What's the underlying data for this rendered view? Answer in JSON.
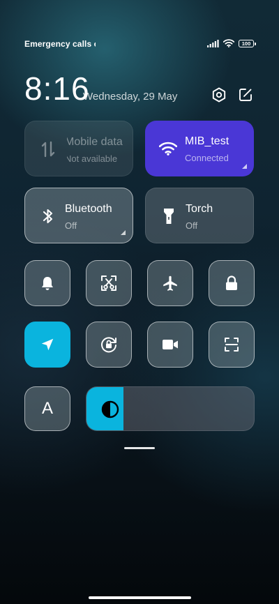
{
  "status_bar": {
    "carrier_text": "Emergency calls o",
    "battery_level": "100"
  },
  "header": {
    "time": "8:16",
    "date": "Wednesday, 29 May"
  },
  "tiles": {
    "mobile_data": {
      "title": "Mobile data",
      "status": "Not available"
    },
    "wifi": {
      "title": "MIB_test",
      "status": "Connected"
    },
    "bluetooth": {
      "title": "Bluetooth",
      "status": "Off"
    },
    "torch": {
      "title": "Torch",
      "status": "Off"
    }
  },
  "toggles": [
    {
      "icon": "bell-icon",
      "active": false
    },
    {
      "icon": "screenshot-icon",
      "active": false
    },
    {
      "icon": "airplane-icon",
      "active": false
    },
    {
      "icon": "lock-icon",
      "active": false
    },
    {
      "icon": "location-icon",
      "active": true
    },
    {
      "icon": "rotation-lock-icon",
      "active": false
    },
    {
      "icon": "video-camera-icon",
      "active": false
    },
    {
      "icon": "scanner-icon",
      "active": false
    }
  ],
  "auto_brightness": {
    "label": "A"
  },
  "brightness": {
    "level": 0.22
  },
  "colors": {
    "accent": "#0ab4de",
    "wifi_active": "#4a37d6"
  }
}
